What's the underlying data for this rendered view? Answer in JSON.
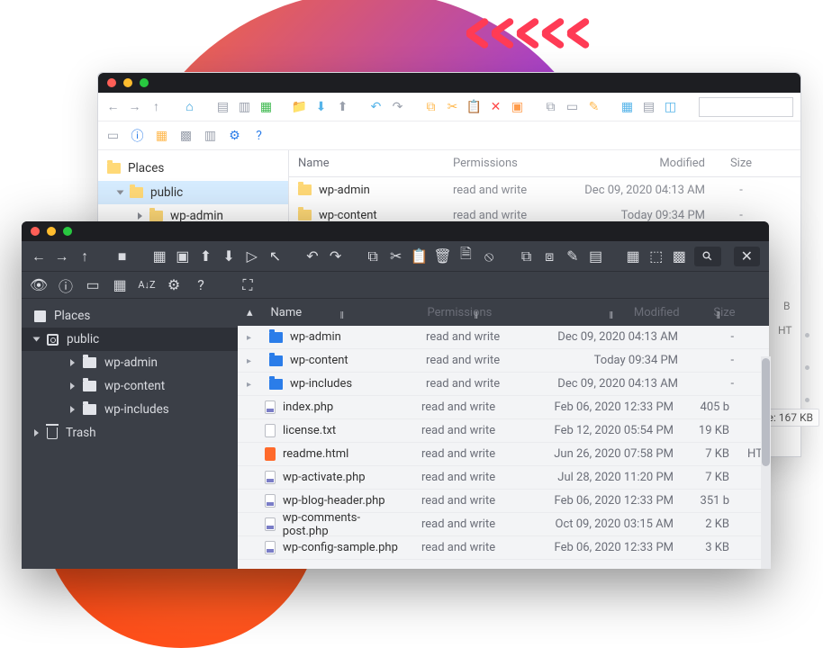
{
  "light": {
    "sidebar": {
      "places_label": "Places",
      "root": "public",
      "children": [
        "wp-admin"
      ]
    },
    "columns": {
      "name": "Name",
      "perm": "Permissions",
      "mod": "Modified",
      "size": "Size"
    },
    "rows": [
      {
        "name": "wp-admin",
        "perm": "read and write",
        "mod": "Dec 09, 2020 04:13 AM",
        "size": "-"
      },
      {
        "name": "wp-content",
        "perm": "read and write",
        "mod": "Today 09:34 PM",
        "size": "-"
      }
    ]
  },
  "dark": {
    "sidebar": {
      "places_label": "Places",
      "root": "public",
      "children": [
        "wp-admin",
        "wp-content",
        "wp-includes"
      ],
      "trash": "Trash"
    },
    "columns": {
      "name": "Name",
      "perm": "Permissions",
      "mod": "Modified",
      "size": "Size"
    },
    "rows": [
      {
        "icon": "folder",
        "name": "wp-admin",
        "perm": "read and write",
        "mod": "Dec 09, 2020 04:13 AM",
        "size": "-",
        "ext": ""
      },
      {
        "icon": "folder",
        "name": "wp-content",
        "perm": "read and write",
        "mod": "Today 09:34 PM",
        "size": "-",
        "ext": ""
      },
      {
        "icon": "folder",
        "name": "wp-includes",
        "perm": "read and write",
        "mod": "Dec 09, 2020 04:13 AM",
        "size": "-",
        "ext": ""
      },
      {
        "icon": "php",
        "name": "index.php",
        "perm": "read and write",
        "mod": "Feb 06, 2020 12:33 PM",
        "size": "405 b",
        "ext": ""
      },
      {
        "icon": "txt",
        "name": "license.txt",
        "perm": "read and write",
        "mod": "Feb 12, 2020 05:54 PM",
        "size": "19 KB",
        "ext": ""
      },
      {
        "icon": "html",
        "name": "readme.html",
        "perm": "read and write",
        "mod": "Jun 26, 2020 07:58 PM",
        "size": "7 KB",
        "ext": "HT"
      },
      {
        "icon": "php",
        "name": "wp-activate.php",
        "perm": "read and write",
        "mod": "Jul 28, 2020 11:20 PM",
        "size": "7 KB",
        "ext": ""
      },
      {
        "icon": "php",
        "name": "wp-blog-header.php",
        "perm": "read and write",
        "mod": "Feb 06, 2020 12:33 PM",
        "size": "351 b",
        "ext": ""
      },
      {
        "icon": "php",
        "name": "wp-comments-post.php",
        "perm": "read and write",
        "mod": "Oct 09, 2020 03:15 AM",
        "size": "2 KB",
        "ext": ""
      },
      {
        "icon": "php",
        "name": "wp-config-sample.php",
        "perm": "read and write",
        "mod": "Feb 06, 2020 12:33 PM",
        "size": "3 KB",
        "ext": ""
      }
    ]
  },
  "status": {
    "size_label": "e: 167 KB"
  },
  "truncated_labels": {
    "b": "B",
    "ht": "HT"
  }
}
